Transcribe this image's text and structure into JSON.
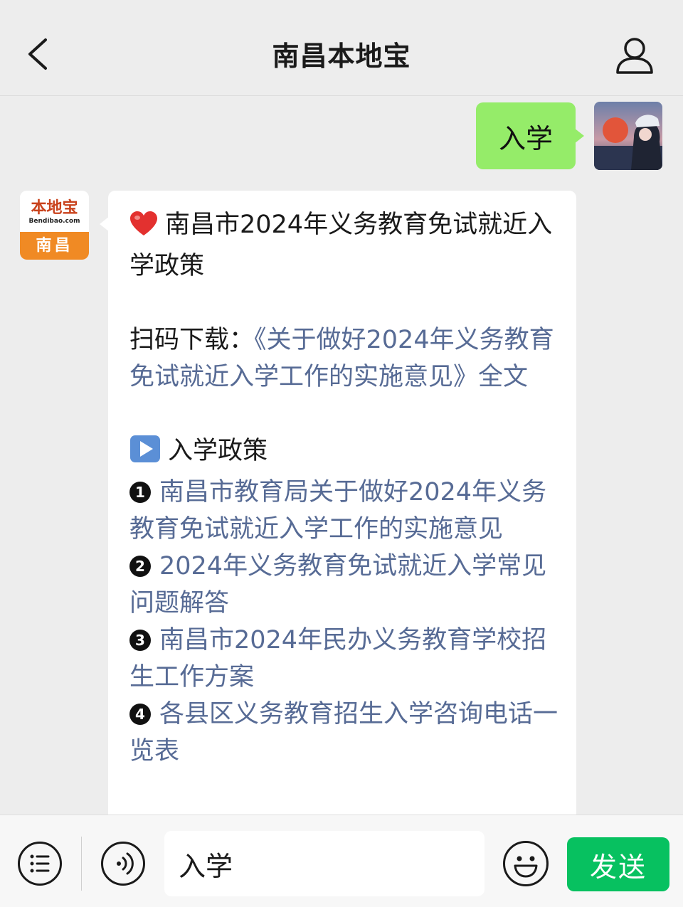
{
  "header": {
    "title": "南昌本地宝"
  },
  "messages": {
    "user": {
      "text": "入学"
    },
    "bot": {
      "avatar": {
        "brand": "本地宝",
        "url": "Bendibao.com",
        "city": "南昌"
      },
      "title_emoji": "red-heart",
      "title": "南昌市2024年义务教育免试就近入学政策",
      "download_label": "扫码下载：",
      "download_link": "《关于做好2024年义务教育免试就近入学工作的实施意见》全文",
      "section_emoji": "play-button",
      "section_title": "入学政策",
      "items": [
        {
          "number": "1",
          "text": "南昌市教育局关于做好2024年义务教育免试就近入学工作的实施意见"
        },
        {
          "number": "2",
          "text": "2024年义务教育免试就近入学常见问题解答"
        },
        {
          "number": "3",
          "text": "南昌市2024年民办义务教育学校招生工作方案"
        },
        {
          "number": "4",
          "text": "各县区义务教育招生入学咨询电话一览表"
        }
      ]
    }
  },
  "input_bar": {
    "input_value": "入学",
    "send_label": "发送",
    "send_color": "#07c160"
  },
  "colors": {
    "background": "#ededed",
    "user_bubble": "#95ec69",
    "link": "#576b95"
  }
}
